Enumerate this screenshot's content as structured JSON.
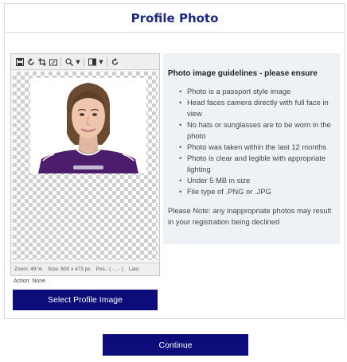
{
  "header": {
    "title": "Profile Photo"
  },
  "editor": {
    "toolbar": [
      {
        "name": "save-icon"
      },
      {
        "name": "rotate-icon"
      },
      {
        "name": "crop-icon"
      },
      {
        "name": "resize-icon"
      },
      {
        "name": "zoom-icon"
      },
      {
        "name": "filter-icon"
      },
      {
        "name": "redo-icon"
      }
    ],
    "status": {
      "zoom": "Zoom: 49 %",
      "size": "Size: 600 x 473 px",
      "pos": "Pos.: ( - , - )",
      "last": "Last"
    },
    "action": "Action: None"
  },
  "select_button": {
    "label": "Select Profile Image"
  },
  "guidelines": {
    "title": "Photo image guidelines - please ensure",
    "items": [
      "Photo is a passport style image",
      "Head faces camera directly with full face in view",
      "No hats or sunglasses are to be worn in the photo",
      "Photo was taken within the last 12 months",
      "Photo is clear and legible with appropriate lighting",
      "Under 5 MB in size",
      "File type of .PNG or .JPG"
    ],
    "note": "Please Note: any inappropriate photos may result in your registration being declined"
  },
  "continue_button": {
    "label": "Continue"
  },
  "colors": {
    "primary": "#0d0c7a",
    "title": "#1c2a78",
    "panel": "#eef1f6"
  }
}
